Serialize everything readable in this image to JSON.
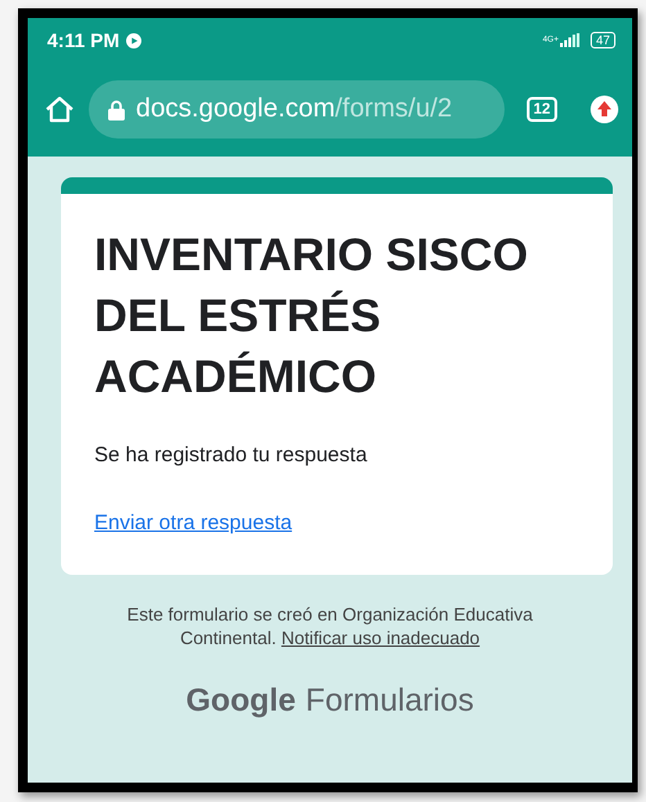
{
  "status_bar": {
    "time": "4:11 PM",
    "network": "4G+",
    "battery": "47"
  },
  "address_bar": {
    "domain": "docs.google.com",
    "path": "/forms/u/2",
    "tab_count": "12"
  },
  "form": {
    "title": "INVENTARIO SISCO DEL ESTRÉS ACADÉMICO",
    "message": "Se ha registrado tu respuesta",
    "link": "Enviar otra respuesta"
  },
  "footer": {
    "text": "Este formulario se creó en Organización Educativa Continental.",
    "link": "Notificar uso inadecuado",
    "brand": "Google",
    "product": "Formularios"
  }
}
